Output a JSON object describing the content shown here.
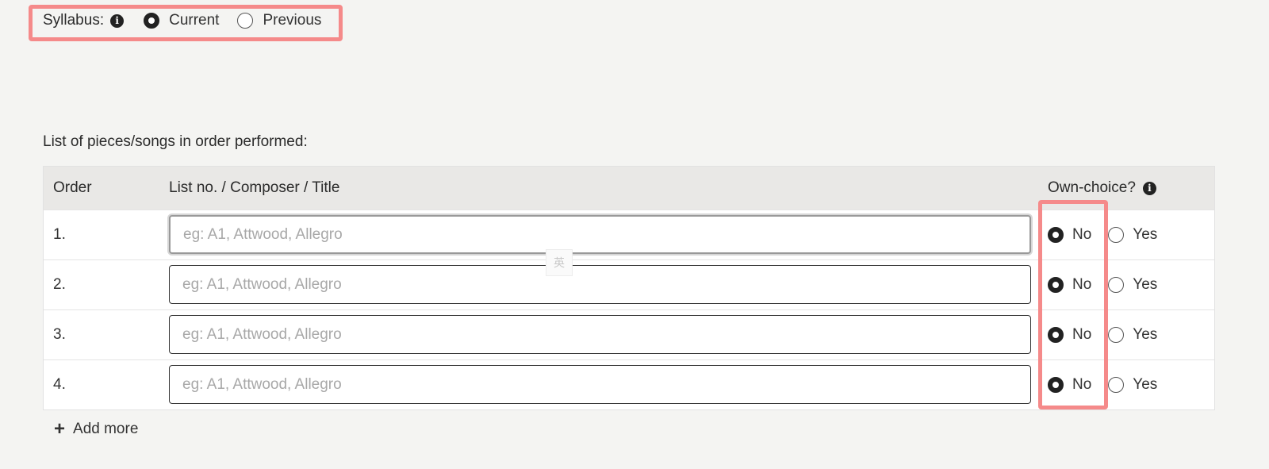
{
  "syllabus": {
    "label": "Syllabus:",
    "info_icon": "i",
    "options": [
      {
        "label": "Current",
        "checked": true
      },
      {
        "label": "Previous",
        "checked": false
      }
    ]
  },
  "pieces": {
    "title": "List of pieces/songs in order performed:",
    "columns": {
      "order": "Order",
      "title": "List no. / Composer / Title",
      "own_choice": "Own-choice?"
    },
    "rows": [
      {
        "order": "1.",
        "placeholder": "eg: A1, Attwood, Allegro",
        "value": "",
        "own_choice": "No"
      },
      {
        "order": "2.",
        "placeholder": "eg: A1, Attwood, Allegro",
        "value": "",
        "own_choice": "No"
      },
      {
        "order": "3.",
        "placeholder": "eg: A1, Attwood, Allegro",
        "value": "",
        "own_choice": "No"
      },
      {
        "order": "4.",
        "placeholder": "eg: A1, Attwood, Allegro",
        "value": "",
        "own_choice": "No"
      }
    ],
    "choice_labels": {
      "no": "No",
      "yes": "Yes"
    },
    "add_more": {
      "icon": "+",
      "label": "Add more"
    }
  },
  "ime_badge": "英",
  "colors": {
    "highlight": "#f58a8a",
    "background": "#f4f4f2",
    "header_bg": "#e9e8e6"
  }
}
